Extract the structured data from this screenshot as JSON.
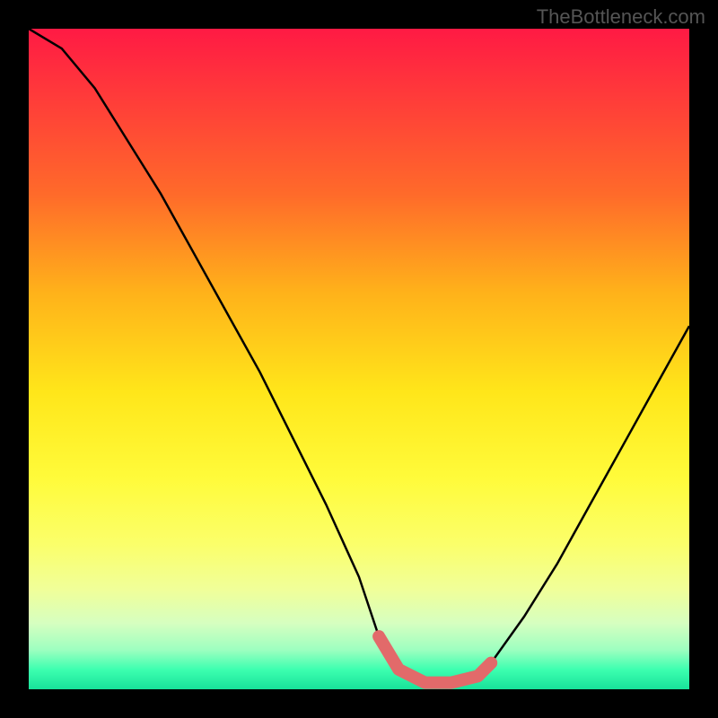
{
  "watermark": "TheBottleneck.com",
  "chart_data": {
    "type": "line",
    "title": "",
    "xlabel": "",
    "ylabel": "",
    "xlim": [
      0,
      100
    ],
    "ylim": [
      0,
      100
    ],
    "series": [
      {
        "name": "bottleneck-curve",
        "x": [
          0,
          5,
          10,
          15,
          20,
          25,
          30,
          35,
          40,
          45,
          50,
          53,
          56,
          60,
          64,
          68,
          70,
          75,
          80,
          85,
          90,
          95,
          100
        ],
        "y": [
          100,
          97,
          91,
          83,
          75,
          66,
          57,
          48,
          38,
          28,
          17,
          8,
          3,
          1,
          1,
          2,
          4,
          11,
          19,
          28,
          37,
          46,
          55
        ]
      },
      {
        "name": "optimal-zone-marker",
        "x": [
          53,
          56,
          60,
          64,
          68,
          70
        ],
        "y": [
          8,
          3,
          1,
          1,
          2,
          4
        ]
      }
    ],
    "colors": {
      "curve": "#000000",
      "marker": "#e26a6a",
      "gradient_top": "#ff1a44",
      "gradient_bottom": "#18e29a"
    }
  }
}
